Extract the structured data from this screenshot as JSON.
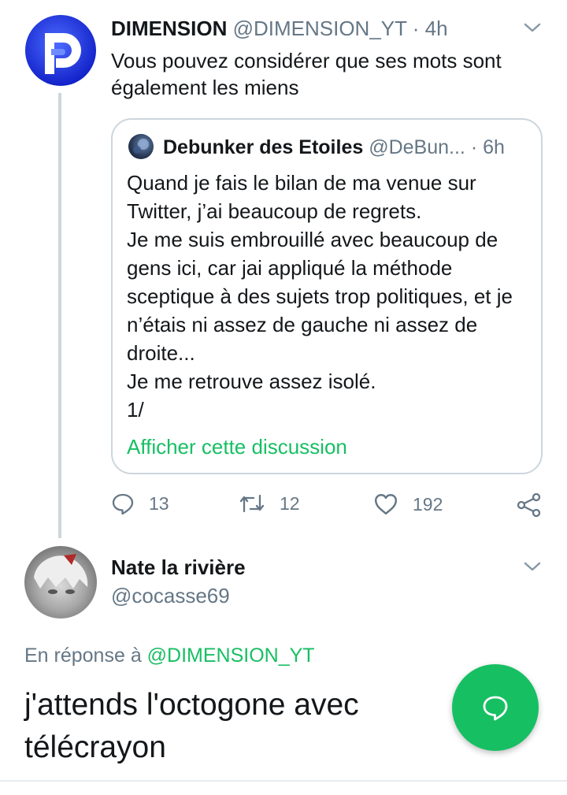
{
  "accent_color": "#17bf63",
  "main_tweet": {
    "author_name": "DIMENSION",
    "handle": "@DIMENSION_YT",
    "separator": "·",
    "time": "4h",
    "text": "Vous pouvez considérer que ses mots sont également les miens",
    "avatar_icon": "dimension-logo-icon",
    "menu_icon": "chevron-down-icon"
  },
  "quoted_tweet": {
    "author_name": "Debunker des Etoiles",
    "handle": "@DeBun...",
    "separator": "·",
    "time": "6h",
    "lines": [
      "Quand je fais le bilan de ma venue sur Twitter, j’ai beaucoup de regrets.",
      "Je me suis embrouillé avec beaucoup de gens ici, car jai appliqué la méthode sceptique à des sujets trop politiques, et je n’étais ni assez de gauche ni assez de droite...",
      "Je me retrouve assez isolé.",
      "1/"
    ],
    "show_thread_link": "Afficher cette discussion"
  },
  "actions": {
    "replies": "13",
    "retweets": "12",
    "likes": "192",
    "icons": [
      "reply-icon",
      "retweet-icon",
      "like-icon",
      "share-icon"
    ]
  },
  "reply_tweet": {
    "author_name": "Nate la rivière",
    "handle": "@cocasse69",
    "reply_prefix": "En réponse à",
    "reply_mention": "@DIMENSION_YT",
    "text": "j'attends l'octogone avec télécrayon",
    "menu_icon": "chevron-down-icon"
  },
  "fab": {
    "icon": "compose-reply-icon"
  }
}
